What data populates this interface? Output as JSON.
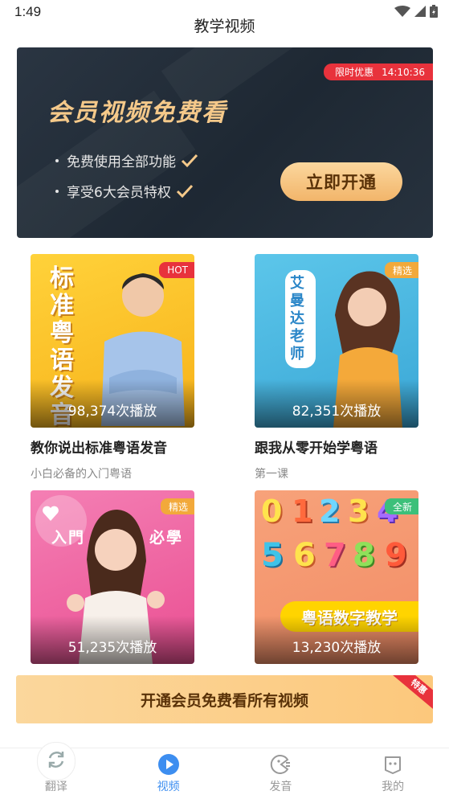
{
  "status": {
    "time": "1:49"
  },
  "header": {
    "title": "教学视频"
  },
  "banner": {
    "promo_label": "限时优惠",
    "countdown": "14:10:36",
    "headline": "会员视频免费看",
    "features": [
      "免费使用全部功能",
      "享受6大会员特权"
    ],
    "button": "立即开通"
  },
  "cards": [
    {
      "tag": "HOT",
      "tag_color": "#e8323c",
      "plays": "98,374次播放",
      "title": "教你说出标准粤语发音",
      "subtitle": "小白必备的入门粤语",
      "art_text": "标准粤语发音"
    },
    {
      "tag": "精选",
      "tag_color": "#f2a93b",
      "plays": "82,351次播放",
      "title": "跟我从零开始学粤语",
      "subtitle": "第一课",
      "art_text": "艾曼达老师"
    },
    {
      "tag": "精选",
      "tag_color": "#f2a93b",
      "plays": "51,235次播放",
      "title": "",
      "subtitle": "",
      "art_text_left": "入門",
      "art_text_right": "必學"
    },
    {
      "tag": "全新",
      "tag_color": "#3cc07a",
      "plays": "13,230次播放",
      "title": "",
      "subtitle": "",
      "art_text": "粤语数字教学",
      "digits": "0123456789"
    }
  ],
  "cta": {
    "label": "开通会员免费看所有视频",
    "corner": "特惠"
  },
  "tabs": [
    {
      "label": "翻译",
      "icon": "refresh-icon",
      "active": false
    },
    {
      "label": "视频",
      "icon": "play-icon",
      "active": true
    },
    {
      "label": "发音",
      "icon": "pronounce-icon",
      "active": false
    },
    {
      "label": "我的",
      "icon": "profile-icon",
      "active": false
    }
  ],
  "colors": {
    "accent": "#3d8ef0",
    "gold": "#f5c98a",
    "promo": "#e8323c"
  }
}
